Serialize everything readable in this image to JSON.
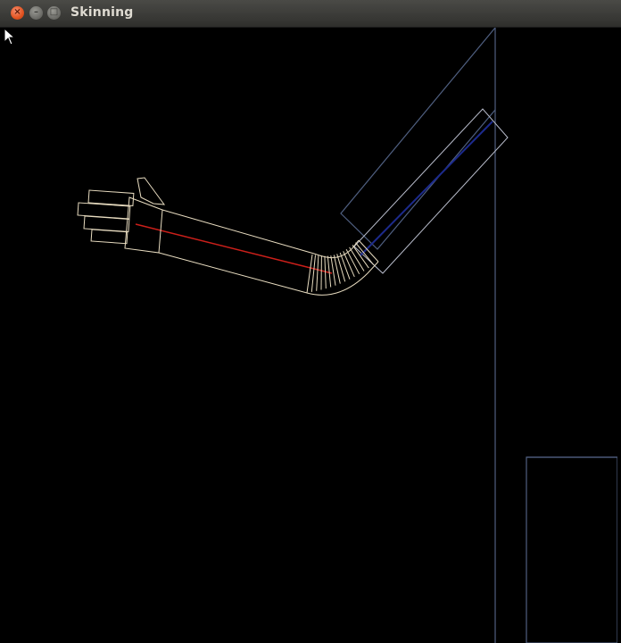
{
  "window": {
    "title": "Skinning",
    "close_glyph": "×",
    "minimize_glyph": "–",
    "maximize_glyph": "□"
  },
  "colors": {
    "skin": "#e8dcc0",
    "bone_upper": "#cc1f1a",
    "bone_lower": "#1c2a8c",
    "bounds": "#4f5f80",
    "background": "#000000"
  },
  "icons": {
    "cursor": "pointer-arrow-icon"
  }
}
